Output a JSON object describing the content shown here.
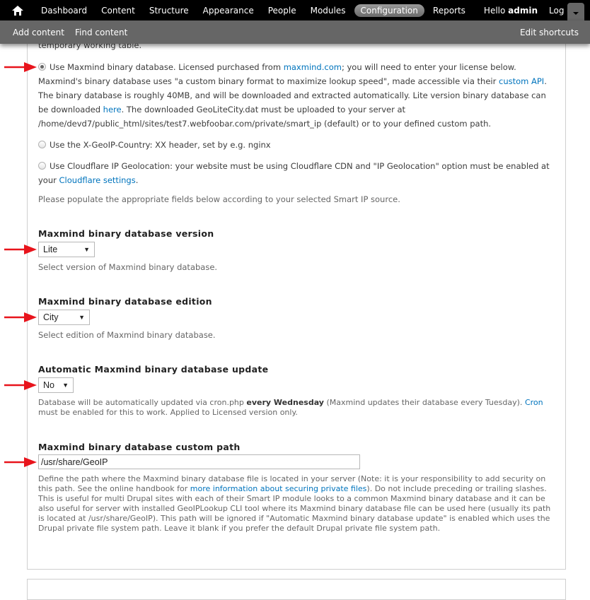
{
  "toolbar": {
    "menu": [
      {
        "label": "Dashboard"
      },
      {
        "label": "Content"
      },
      {
        "label": "Structure"
      },
      {
        "label": "Appearance"
      },
      {
        "label": "People"
      },
      {
        "label": "Modules"
      },
      {
        "label": "Configuration",
        "active": true
      },
      {
        "label": "Reports"
      }
    ],
    "hello_prefix": "Hello ",
    "username": "admin",
    "logout": "Log out",
    "shortcuts": [
      {
        "label": "Add content"
      },
      {
        "label": "Find content"
      }
    ],
    "edit_shortcuts": "Edit shortcuts"
  },
  "source": {
    "partial_top_text": "temporary working table.",
    "maxmind": {
      "t1": "Use Maxmind binary database. Licensed purchased from ",
      "link1": "maxmind.com",
      "t2": "; you will need to enter your license below. Maxmind's binary database uses \"a custom binary format to maximize lookup speed\", made accessible via their ",
      "link2": "custom API",
      "t3": ". The binary database is roughly 40MB, and will be downloaded and extracted automatically. Lite version binary database can be downloaded ",
      "link3": "here",
      "t4": ". The downloaded GeoLiteCity.dat must be uploaded to your server at /home/devd7/public_html/sites/test7.webfoobar.com/private/smart_ip (default) or to your defined custom path.",
      "checked": true
    },
    "xgeoip": {
      "label": "Use the X-GeoIP-Country: XX header, set by e.g. nginx",
      "checked": false
    },
    "cloudflare": {
      "t1": "Use Cloudflare IP Geolocation: your website must be using Cloudflare CDN and \"IP Geolocation\" option must be enabled at your ",
      "link": "Cloudflare settings",
      "t2": ".",
      "checked": false
    },
    "populate_note": "Please populate the appropriate fields below according to your selected Smart IP source."
  },
  "fields": {
    "version": {
      "label": "Maxmind binary database version",
      "value": "Lite",
      "description": "Select version of Maxmind binary database."
    },
    "edition": {
      "label": "Maxmind binary database edition",
      "value": "City",
      "description": "Select edition of Maxmind binary database."
    },
    "auto_update": {
      "label": "Automatic Maxmind binary database update",
      "value": "No",
      "d1": "Database will be automatically updated via cron.php ",
      "d_bold": "every Wednesday",
      "d2": " (Maxmind updates their database every Tuesday). ",
      "d_link": "Cron",
      "d3": " must be enabled for this to work. Applied to Licensed version only."
    },
    "custom_path": {
      "label": "Maxmind binary database custom path",
      "value": "/usr/share/GeoIP",
      "d1": "Define the path where the Maxmind binary database file is located in your server (Note: it is your responsibility to add security on this path. See the online handbook for ",
      "d_link": "more information about securing private files",
      "d2": "). Do not include preceding or trailing slashes. This is useful for multi Drupal sites with each of their Smart IP module looks to a common Maxmind binary database and it can be also useful for server with installed GeoIPLookup CLI tool where its Maxmind binary database file can be used here (usually its path is located at /usr/share/GeoIP). This path will be ignored if \"Automatic Maxmind binary database update\" is enabled which uses the Drupal private file system path. Leave it blank if you prefer the default Drupal private file system path."
    }
  },
  "colors": {
    "link": "#0074bd",
    "annotation_arrow": "#e8141c"
  }
}
